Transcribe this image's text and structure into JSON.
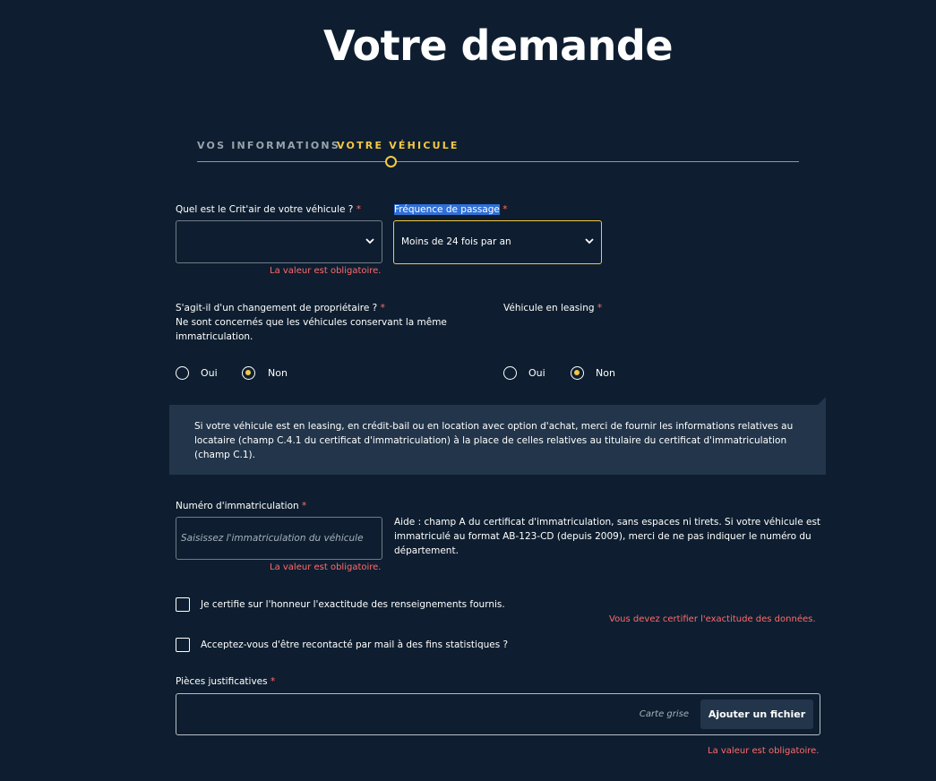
{
  "page_title": "Votre demande",
  "stepper": {
    "step1": "VOS INFORMATIONS",
    "step2": "VOTRE VÉHICULE"
  },
  "required_marker": "*",
  "critair": {
    "label": "Quel est le Crit'air de votre véhicule ?",
    "value": "",
    "error": "La valeur est obligatoire."
  },
  "frequence": {
    "label": "Fréquence de passage",
    "value": "Moins de 24 fois par an"
  },
  "proprietaire": {
    "label": "S'agit-il d'un changement de propriétaire ?",
    "sub": "Ne sont concernés que les véhicules conservant la même immatriculation.",
    "options": [
      "Oui",
      "Non"
    ],
    "selected": "Non"
  },
  "leasing": {
    "label": "Véhicule en leasing",
    "options": [
      "Oui",
      "Non"
    ],
    "selected": "Non"
  },
  "info_box": "Si votre véhicule est en leasing, en crédit-bail ou en location avec option d'achat, merci de fournir les informations relatives au locataire (champ C.4.1 du certificat d'immatriculation) à la place de celles relatives au titulaire du certificat d'immatriculation (champ C.1).",
  "immat": {
    "label": "Numéro d'immatriculation",
    "placeholder": "Saisissez l'immatriculation du véhicule",
    "help": "Aide : champ A du certificat d'immatriculation, sans espaces ni tirets. Si votre véhicule est immatriculé au format AB-123-CD (depuis 2009), merci de ne pas indiquer le numéro du département.",
    "error": "La valeur est obligatoire."
  },
  "certify": {
    "label": "Je certifie sur l'honneur l'exactitude des renseignements fournis.",
    "error": "Vous devez certifier l'exactitude des données."
  },
  "contact": {
    "label": "Acceptez-vous d'être recontacté par mail à des fins statistiques ?"
  },
  "pieces": {
    "label": "Pièces justificatives",
    "hint": "Carte grise",
    "button": "Ajouter un fichier",
    "error": "La valeur est obligatoire."
  }
}
